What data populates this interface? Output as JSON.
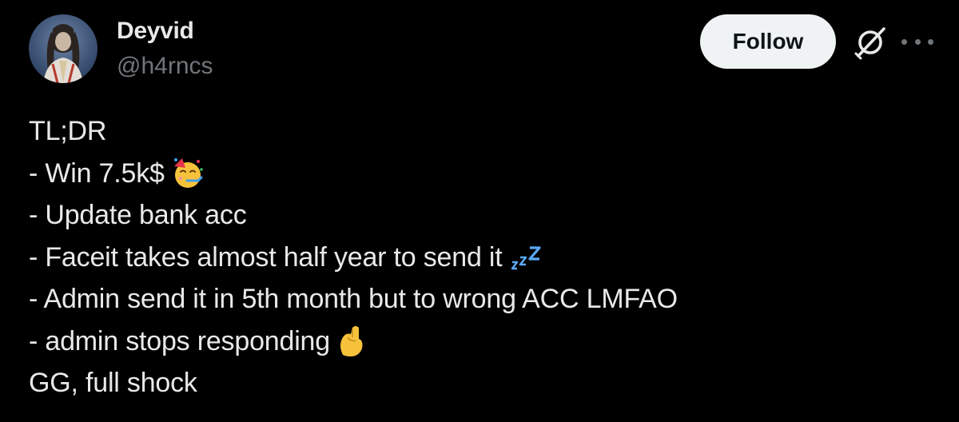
{
  "author": {
    "display_name": "Deyvid",
    "handle": "@h4rncs",
    "avatar_icon": "profile-avatar"
  },
  "actions": {
    "follow_label": "Follow",
    "grok_icon": "grok-icon",
    "more_icon": "more-options-icon"
  },
  "tweet": {
    "lines": [
      {
        "text": "TL;DR",
        "emoji": null
      },
      {
        "text": "- Win 7.5k$",
        "emoji": "partying-face-emoji"
      },
      {
        "text": "- Update bank acc",
        "emoji": null
      },
      {
        "text": "- Faceit takes almost half year to send it",
        "emoji": "zzz-emoji"
      },
      {
        "text": "- Admin send it in 5th month but to wrong ACC LMFAO",
        "emoji": null
      },
      {
        "text": "- admin stops responding",
        "emoji": "pinched-fingers-emoji"
      },
      {
        "text": "GG, full shock",
        "emoji": null
      }
    ]
  },
  "colors": {
    "background": "#000000",
    "text_primary": "#e7e9ea",
    "text_secondary": "#71767b",
    "button_bg": "#eff3f4",
    "button_text": "#0f1419"
  }
}
